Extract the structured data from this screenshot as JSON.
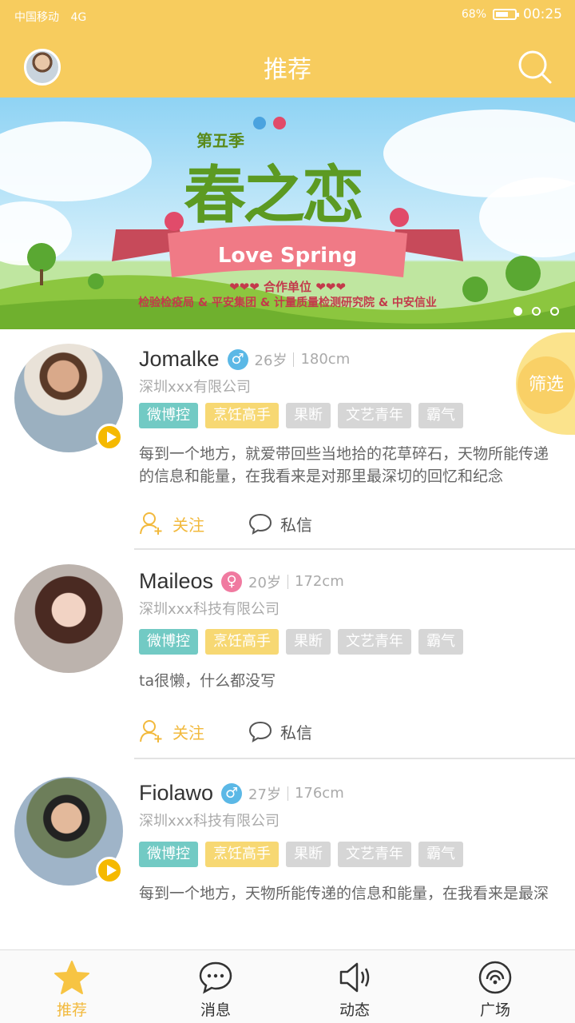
{
  "status": {
    "carrier": "中国移动",
    "network": "4G",
    "battery": "68%",
    "battery_level": 0.68,
    "time": "00:25"
  },
  "header": {
    "title": "推荐"
  },
  "banner": {
    "season": "第五季",
    "logo": "春之恋",
    "ribbon": "Love Spring",
    "coop": "❤❤❤ 合作单位 ❤❤❤",
    "partners": "检验检疫局 & 平安集团 & 计量质量检测研究院 & 中安信业",
    "slide_count": 3,
    "active_slide": 1
  },
  "filter": {
    "label": "筛选"
  },
  "users": [
    {
      "name": "Jomalke",
      "gender": "male",
      "gender_symbol": "♂",
      "age": "26岁",
      "height": "180cm",
      "company": "深圳xxx有限公司",
      "tags": [
        "微博控",
        "烹饪高手",
        "果断",
        "文艺青年",
        "霸气"
      ],
      "desc": "每到一个地方，就爱带回些当地拾的花草碎石，天物所能传递的信息和能量，在我看来是对那里最深切的回忆和纪念",
      "has_video": true,
      "follow_label": "关注",
      "message_label": "私信"
    },
    {
      "name": "Maileos",
      "gender": "female",
      "gender_symbol": "♀",
      "age": "20岁",
      "height": "172cm",
      "company": "深圳xxx科技有限公司",
      "tags": [
        "微博控",
        "烹饪高手",
        "果断",
        "文艺青年",
        "霸气"
      ],
      "desc": "ta很懒，什么都没写",
      "has_video": false,
      "follow_label": "关注",
      "message_label": "私信"
    },
    {
      "name": "Fiolawo",
      "gender": "male",
      "gender_symbol": "♂",
      "age": "27岁",
      "height": "176cm",
      "company": "深圳xxx科技有限公司",
      "tags": [
        "微博控",
        "烹饪高手",
        "果断",
        "文艺青年",
        "霸气"
      ],
      "desc": "每到一个地方，天物所能传递的信息和能量，在我看来是最深",
      "has_video": true,
      "follow_label": "关注",
      "message_label": "私信"
    }
  ],
  "tabs": [
    {
      "label": "推荐",
      "icon": "star-icon",
      "active": true
    },
    {
      "label": "消息",
      "icon": "chat-bubble-icon",
      "active": false
    },
    {
      "label": "动态",
      "icon": "speaker-icon",
      "active": false
    },
    {
      "label": "广场",
      "icon": "broadcast-icon",
      "active": false
    }
  ],
  "colors": {
    "header": "#f7cc5e",
    "accent": "#f2b93c",
    "tag_teal": "#72cac4",
    "tag_yellow": "#f7d873",
    "tag_gray": "#d6d6d6"
  }
}
